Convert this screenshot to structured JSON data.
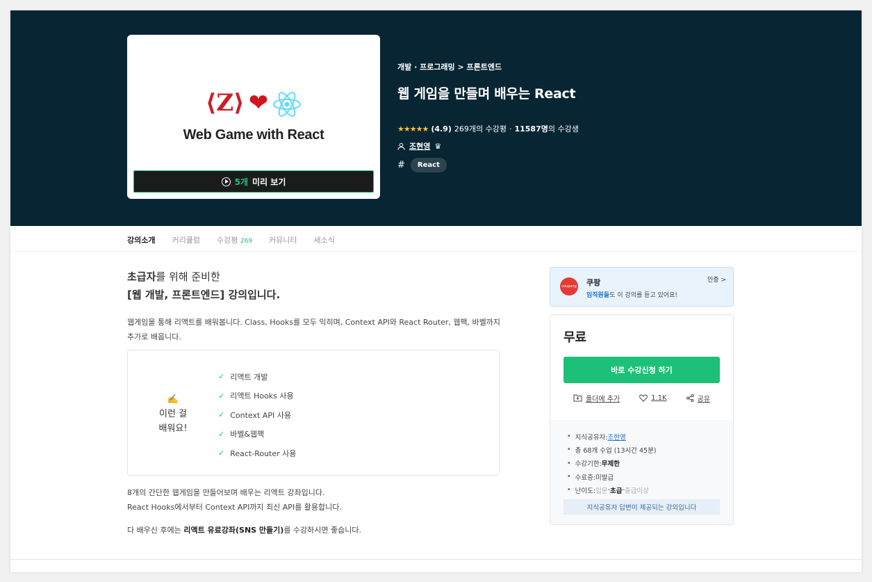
{
  "hero": {
    "thumb_title": "Web Game with React",
    "preview_count": "5개",
    "preview_label": "미리 보기",
    "breadcrumb": "개발 · 프로그래밍 > 프론트엔드",
    "title": "웹 게임을 만들며 배우는 React",
    "stars": "★★★★★",
    "rating": "(4.9)",
    "reviews": "269개의 수강평",
    "students": "11587명",
    "students_suffix": "의 수강생",
    "instructor": "조현영",
    "tag": "React"
  },
  "tabs": [
    {
      "label": "강의소개"
    },
    {
      "label": "커리큘럼"
    },
    {
      "label": "수강평",
      "count": "269"
    },
    {
      "label": "커뮤니티"
    },
    {
      "label": "새소식"
    }
  ],
  "main": {
    "intro_bold": "초급자",
    "intro_rest": "를 위해 준비한",
    "intro_line2": "[웹 개발, 프론트엔드] 강의입니다.",
    "desc": "웹게임을 통해 리액트를 배워봅니다. Class, Hooks를 모두 익히며, Context API와 React Router, 웹팩, 바벨까지 추가로 배웁니다.",
    "learn_emoji": "✍️",
    "learn_title_1": "이런 걸",
    "learn_title_2": "배워요!",
    "learn_items": [
      "리액트 개발",
      "리액트 Hooks 사용",
      "Context API 사용",
      "바벨&웹팩",
      "React-Router 사용"
    ],
    "para1_line1": "8개의 간단한 웹게임을 만들어보며 배우는 리액트 강좌입니다.",
    "para1_line2": "React Hooks에서부터 Context API까지 최신 API를 활용합니다.",
    "para2_pre": "다 배우신 후에는 ",
    "para2_bold": "리액트 유료강좌(SNS 만들기)",
    "para2_post": "를 수강하시면 좋습니다."
  },
  "sidebar": {
    "coupang_logo": "coupang",
    "coupang_name": "쿠팡",
    "coupang_highlight": "임직원들",
    "coupang_sub": "도 이 강의를 듣고 있어요!",
    "coupang_link": "인증 >",
    "price": "무료",
    "enroll_label": "바로 수강신청 하기",
    "folder_label": "폴더에 추가",
    "like_count": "1.1K",
    "share_label": "공유",
    "meta": {
      "instructor_label": "지식공유자: ",
      "instructor": "조현영",
      "lessons": "총 68개 수업 (13시간 45분)",
      "period_label": "수강기한: ",
      "period": "무제한",
      "cert_label": "수료증: ",
      "cert": "미발급",
      "level_label": "난이도: ",
      "level_1": "입문",
      "level_sep1": " - ",
      "level_2": "초급",
      "level_sep2": " - ",
      "level_3": "중급이상"
    },
    "notice": "지식공유자 답변이 제공되는 강의입니다"
  },
  "colors": {
    "hero_bg": "#082533",
    "accent": "#1dc078",
    "star": "#fdc02f"
  }
}
